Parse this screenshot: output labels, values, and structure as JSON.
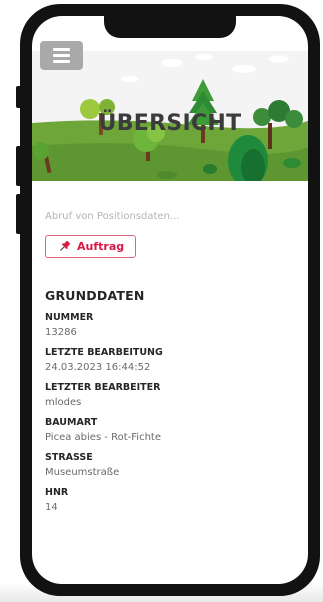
{
  "hero": {
    "title": "ÜBERSICHT"
  },
  "menu": {
    "icon": "hamburger-icon"
  },
  "status_text": "Abruf von Positionsdaten...",
  "auftrag_button": {
    "label": "Auftrag",
    "icon": "pin-icon",
    "color": "#d81a45"
  },
  "grunddaten": {
    "title": "GRUNDDATEN",
    "fields": [
      {
        "label": "NUMMER",
        "value": "13286"
      },
      {
        "label": "LETZTE BEARBEITUNG",
        "value": "24.03.2023 16:44:52"
      },
      {
        "label": "LETZTER BEARBEITER",
        "value": "mlodes"
      },
      {
        "label": "BAUMART",
        "value": "Picea abies - Rot-Fichte"
      },
      {
        "label": "STRASSE",
        "value": "Museumstraße"
      },
      {
        "label": "HNR",
        "value": "14"
      }
    ]
  }
}
